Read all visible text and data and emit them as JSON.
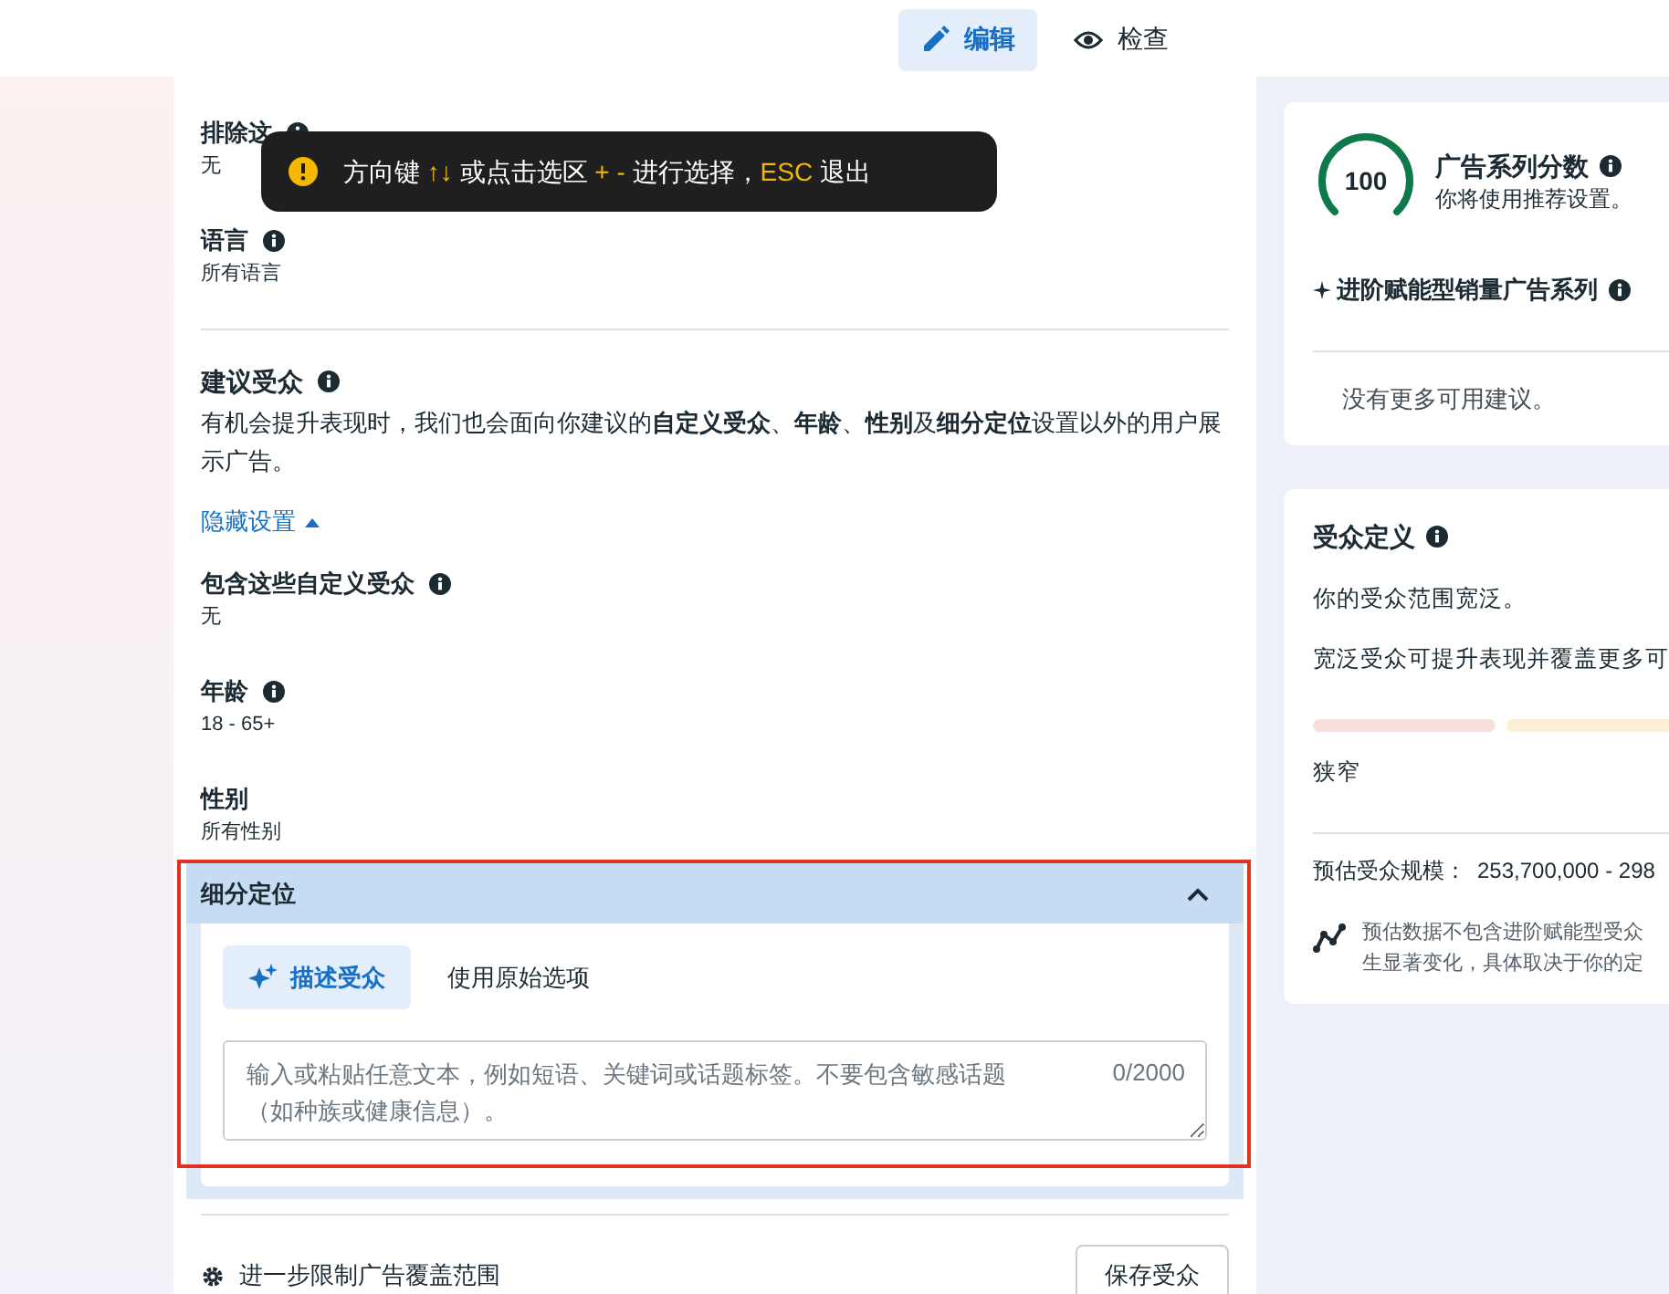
{
  "mode_tabs": [
    {
      "label": "编辑",
      "kind": "edit",
      "selected": true
    },
    {
      "label": "检查",
      "kind": "view",
      "selected": false
    }
  ],
  "tooltip": {
    "segments": [
      {
        "text": "方向键 ",
        "highlight": false
      },
      {
        "text": "↑↓",
        "highlight": true
      },
      {
        "text": " 或点击选区 ",
        "highlight": false
      },
      {
        "text": "+ -",
        "highlight": true
      },
      {
        "text": " 进行选择，",
        "highlight": false
      },
      {
        "text": "ESC",
        "highlight": true
      },
      {
        "text": " 退出",
        "highlight": false
      }
    ]
  },
  "settings": [
    {
      "label": "排除这",
      "info": true,
      "value": "无"
    },
    {
      "label": "语言",
      "info": true,
      "value": "所有语言"
    }
  ],
  "suggested": {
    "title": "建议受众",
    "description": "有机会提升表现时，我们也会面向你建议的**自定义受众**、**年龄**、**性别**及**细分定位**设置以外的用户展示广告。",
    "toggle": "隐藏设置",
    "expanded": true
  },
  "suggested_settings": [
    {
      "label": "包含这些自定义受众",
      "info": true,
      "value": "无"
    },
    {
      "label": "年龄",
      "info": true,
      "value": "18 - 65+"
    },
    {
      "label": "性别",
      "info": false,
      "value": "所有性别"
    }
  ],
  "detailed_targeting": {
    "title": "细分定位",
    "expanded": true,
    "highlighted": true,
    "tabs": [
      {
        "label": "描述受众",
        "selected": true
      },
      {
        "label": "使用原始选项",
        "selected": false
      }
    ],
    "input": {
      "placeholder": "输入或粘贴任意文本，例如短语、关键词或话题标签。不要包含敏感话题（如种族或健康信息）。",
      "counter": "0/2000"
    }
  },
  "footer": {
    "link": "进一步限制广告覆盖范围",
    "button": "保存受众"
  },
  "score_card": {
    "score": "100",
    "title": "广告系列分数",
    "subtitle": "你将使用推荐设置。",
    "campaign": "进阶赋能型销量广告系列",
    "note": "没有更多可用建议。"
  },
  "audience_card": {
    "title": "受众定义",
    "summary": "你的受众范围宽泛。",
    "detail": "宽泛受众可提升表现并覆盖更多可",
    "meter": [
      {
        "color": "#f9dede"
      },
      {
        "color": "#fcefd6"
      }
    ],
    "low_label": "狭窄",
    "size_label": "预估受众规模：",
    "size_value": "253,700,000 - 298",
    "estimate_note": [
      "预估数据不包含进阶赋能型受众",
      "生显著变化，具体取决于你的定"
    ]
  }
}
